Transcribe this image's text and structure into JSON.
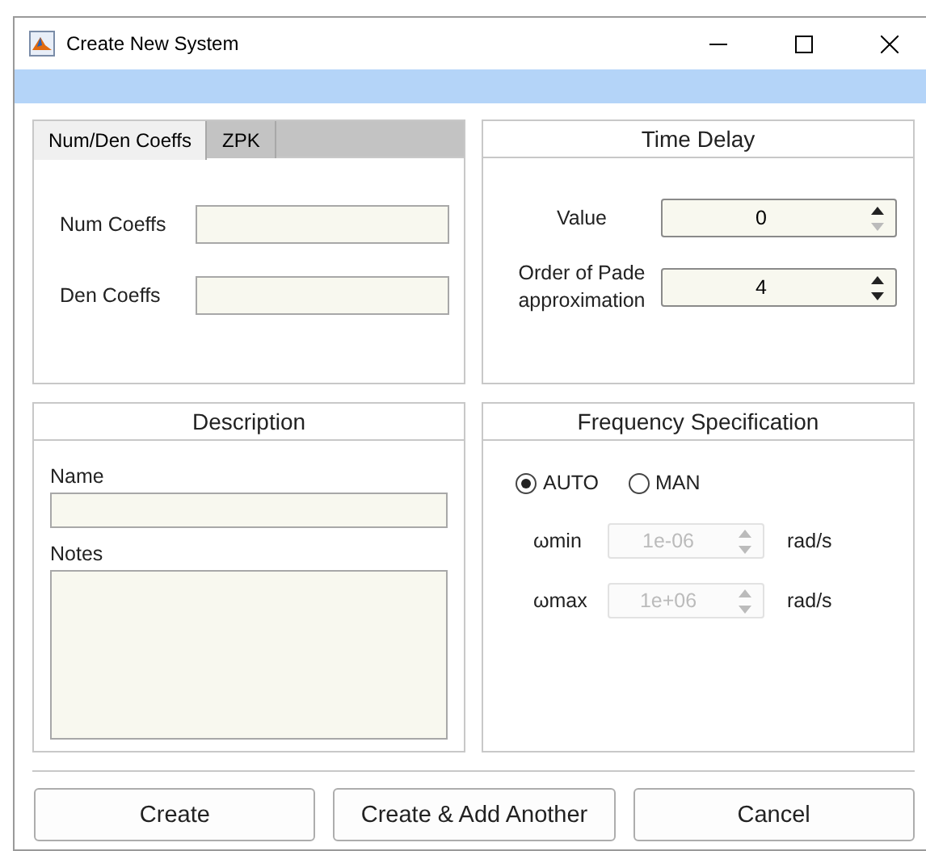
{
  "window": {
    "title": "Create New System"
  },
  "tabs": [
    {
      "label": "Num/Den Coeffs",
      "selected": true
    },
    {
      "label": "ZPK",
      "selected": false
    }
  ],
  "coeff_fields": [
    {
      "label": "Num Coeffs"
    },
    {
      "label": "Den Coeffs"
    }
  ],
  "time_delay": {
    "title": "Time Delay",
    "fields": [
      {
        "label": "Value",
        "value": "0",
        "down_disabled": true
      },
      {
        "label": "Order of Pade approximation",
        "value": "4",
        "down_disabled": false
      }
    ]
  },
  "description": {
    "title": "Description",
    "name_label": "Name",
    "notes_label": "Notes"
  },
  "frequency": {
    "title": "Frequency Specification",
    "modes": [
      {
        "label": "AUTO",
        "selected": true
      },
      {
        "label": "MAN",
        "selected": false
      }
    ],
    "ranges": [
      {
        "label": "ωmin",
        "value": "1e-06",
        "unit": "rad/s",
        "disabled": true
      },
      {
        "label": "ωmax",
        "value": "1e+06",
        "unit": "rad/s",
        "disabled": true
      }
    ]
  },
  "buttons": [
    "Create",
    "Create & Add Another",
    "Cancel"
  ]
}
